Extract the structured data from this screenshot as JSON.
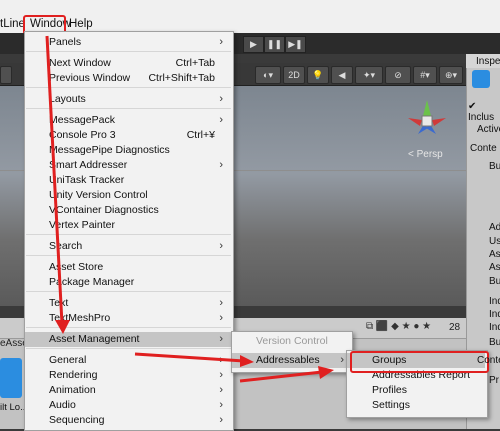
{
  "menubar": {
    "items": [
      "tLine",
      "Window",
      "Help"
    ]
  },
  "toolbar": {
    "play": "▶",
    "pause": "❚❚",
    "step": "▶❚"
  },
  "scene": {
    "mode_2d": "2D",
    "persp_label": "< Persp"
  },
  "inspector": {
    "title": "Inspe",
    "include": "Inclus",
    "lines": [
      "Active",
      "Conte",
      "Bu",
      "Ad",
      "Us",
      "As",
      "As",
      "Bu",
      "Ind",
      "Ind",
      "Ind",
      "Bu",
      "Conte",
      "Pr"
    ]
  },
  "bottom_panel": {
    "count": "28",
    "left_label": "eAsse",
    "asset_label": "ilt Lo..."
  },
  "window_menu": {
    "items": [
      {
        "label": "Panels",
        "shortcut": "",
        "arrow": true
      },
      {
        "label": "Next Window",
        "shortcut": "Ctrl+Tab",
        "arrow": false
      },
      {
        "label": "Previous Window",
        "shortcut": "Ctrl+Shift+Tab",
        "arrow": false
      },
      {
        "label": "Layouts",
        "shortcut": "",
        "arrow": true
      },
      {
        "label": "MessagePack",
        "shortcut": "",
        "arrow": true
      },
      {
        "label": "Console Pro 3",
        "shortcut": "Ctrl+¥",
        "arrow": false
      },
      {
        "label": "MessagePipe Diagnostics",
        "shortcut": "",
        "arrow": false
      },
      {
        "label": "Smart Addresser",
        "shortcut": "",
        "arrow": true
      },
      {
        "label": "UniTask Tracker",
        "shortcut": "",
        "arrow": false
      },
      {
        "label": "Unity Version Control",
        "shortcut": "",
        "arrow": false
      },
      {
        "label": "VContainer Diagnostics",
        "shortcut": "",
        "arrow": false
      },
      {
        "label": "Vertex Painter",
        "shortcut": "",
        "arrow": false
      },
      {
        "label": "Search",
        "shortcut": "",
        "arrow": true
      },
      {
        "label": "Asset Store",
        "shortcut": "",
        "arrow": false
      },
      {
        "label": "Package Manager",
        "shortcut": "",
        "arrow": false
      },
      {
        "label": "Text",
        "shortcut": "",
        "arrow": true
      },
      {
        "label": "TextMeshPro",
        "shortcut": "",
        "arrow": true
      },
      {
        "label": "Asset Management",
        "shortcut": "",
        "arrow": true
      },
      {
        "label": "General",
        "shortcut": "",
        "arrow": true
      },
      {
        "label": "Rendering",
        "shortcut": "",
        "arrow": true
      },
      {
        "label": "Animation",
        "shortcut": "",
        "arrow": true
      },
      {
        "label": "Audio",
        "shortcut": "",
        "arrow": true
      },
      {
        "label": "Sequencing",
        "shortcut": "",
        "arrow": true
      }
    ]
  },
  "asset_mgmt_menu": {
    "items": [
      {
        "label": "Version Control",
        "disabled": true
      },
      {
        "label": "Addressables",
        "disabled": false
      }
    ]
  },
  "addressables_menu": {
    "items": [
      "Groups",
      "Addressables Report",
      "Profiles",
      "Settings"
    ]
  },
  "colors": {
    "annotation_red": "#e02020",
    "menu_bg": "#f2f2f2",
    "highlight": "#c5c5c5"
  }
}
